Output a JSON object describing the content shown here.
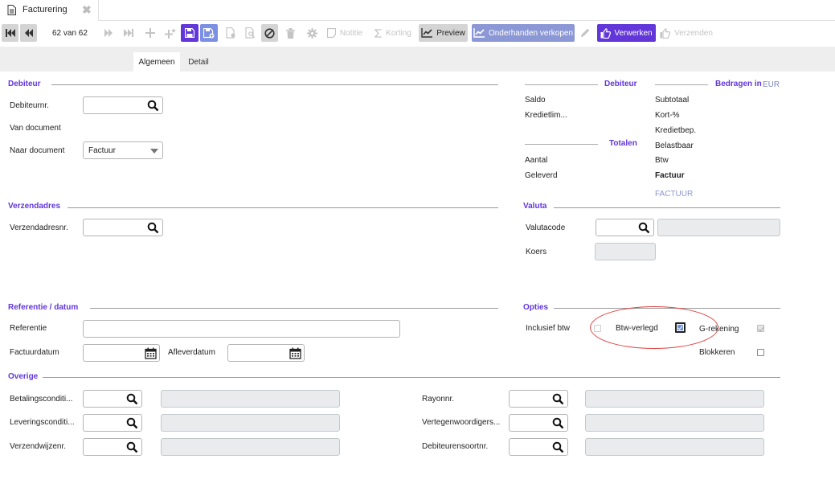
{
  "window": {
    "tab_label": "Facturering",
    "tab_icon": "document-icon",
    "close_icon": "close-icon"
  },
  "toolbar": {
    "counter": "62 van 62",
    "notitie": "Notitie",
    "korting": "Korting",
    "preview": "Preview",
    "onderhanden": "Onderhanden verkopen",
    "verwerken": "Verwerken",
    "verzenden": "Verzenden",
    "colors": {
      "purple": "#6236d9",
      "lavender": "#8c98d6",
      "blue": "#7b8fe3"
    }
  },
  "tabs": [
    {
      "label": "Algemeen",
      "active": true
    },
    {
      "label": "Detail",
      "active": false
    }
  ],
  "debiteur": {
    "title": "Debiteur",
    "debiteurnr_label": "Debiteurnr.",
    "debiteurnr_value": "",
    "van_document_label": "Van document",
    "naar_document_label": "Naar document",
    "naar_document_value": "Factuur"
  },
  "summary": {
    "debiteur_title": "Debiteur",
    "bedragen_title": "Bedragen in",
    "currency": "EUR",
    "totalen_title": "Totalen",
    "saldo": "Saldo",
    "kredietlim": "Kredietlim...",
    "aantal": "Aantal",
    "geleverd": "Geleverd",
    "subtotaal": "Subtotaal",
    "kort": "Kort-%",
    "kredietbep": "Kredietbep.",
    "belastbaar": "Belastbaar",
    "btw": "Btw",
    "factuur": "Factuur",
    "document_type": "FACTUUR"
  },
  "verzendadres": {
    "title": "Verzendadres",
    "nr_label": "Verzendadresnr."
  },
  "valuta": {
    "title": "Valuta",
    "code_label": "Valutacode",
    "koers_label": "Koers"
  },
  "referentie": {
    "title": "Referentie / datum",
    "referentie_label": "Referentie",
    "factuurdatum_label": "Factuurdatum",
    "afleverdatum_label": "Afleverdatum"
  },
  "opties": {
    "title": "Opties",
    "inclusief_btw": "Inclusief btw",
    "btw_verlegd": "Btw-verlegd",
    "g_rekening": "G-rekening",
    "blokkeren": "Blokkeren",
    "highlight_color": "#e04141"
  },
  "overige": {
    "title": "Overige",
    "betalingscondities": "Betalingsconditi...",
    "leveringscondities": "Leveringsconditi...",
    "verzendwijze": "Verzendwijzenr.",
    "rayonnr": "Rayonnr.",
    "vertegenwoordiger": "Vertegenwoordigers...",
    "debiteurensoort": "Debiteurensoortnr."
  }
}
